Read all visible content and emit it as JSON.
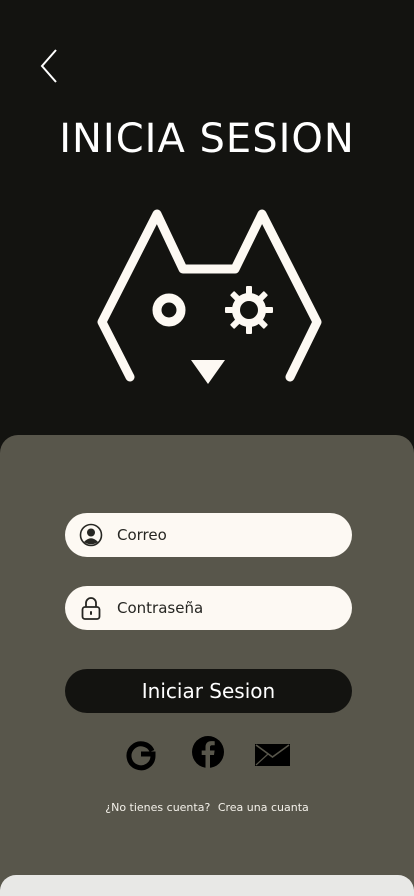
{
  "header": {
    "back_icon": "chevron-left-icon",
    "title": "INICIA SESION"
  },
  "logo": {
    "icon": "cat-gear-logo"
  },
  "form": {
    "email": {
      "placeholder": "Correo",
      "icon": "user-circle-icon"
    },
    "password": {
      "placeholder": "Contraseña",
      "icon": "lock-icon"
    },
    "submit_label": "Iniciar Sesion"
  },
  "social": {
    "google_icon": "google-icon",
    "facebook_icon": "facebook-icon",
    "email_icon": "mail-icon"
  },
  "signup": {
    "question": "¿No tienes cuenta?",
    "link": "Crea una cuanta"
  },
  "colors": {
    "background": "#131310",
    "panel": "#58564b",
    "field": "#fdf9f3",
    "accent_light": "#fdf9f3"
  }
}
